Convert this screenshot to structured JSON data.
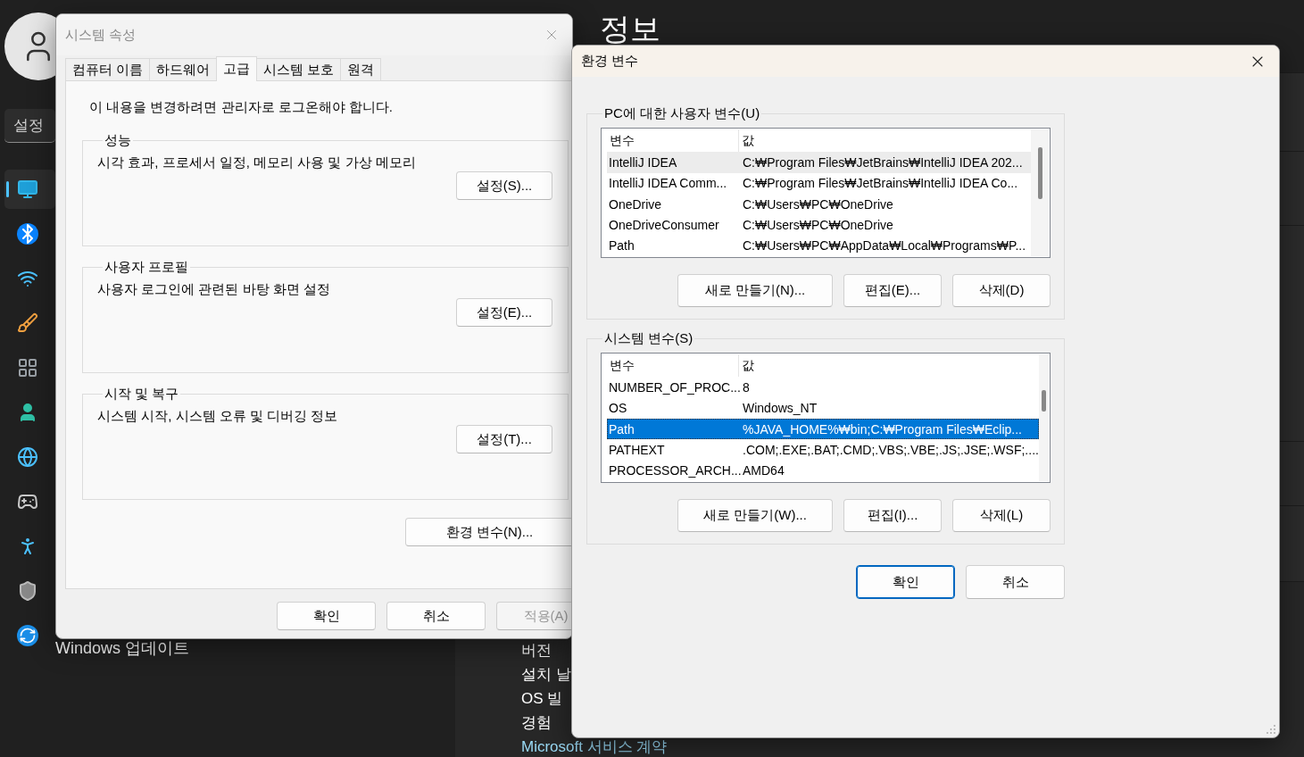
{
  "settings_app": {
    "heading": "정보",
    "search": {
      "placeholder": "설정"
    },
    "nav_items": [
      {
        "kind": "display",
        "selected": true
      },
      {
        "kind": "bluetooth",
        "selected": false
      },
      {
        "kind": "wifi",
        "selected": false
      },
      {
        "kind": "brush",
        "selected": false
      },
      {
        "kind": "apps",
        "selected": false
      },
      {
        "kind": "person",
        "selected": false
      },
      {
        "kind": "time",
        "selected": false
      },
      {
        "kind": "gaming",
        "selected": false
      },
      {
        "kind": "accessibility",
        "selected": false
      },
      {
        "kind": "shield",
        "selected": false
      },
      {
        "kind": "update",
        "selected": false,
        "label": "Windows 업데이트"
      }
    ],
    "info_rows": [
      "버전",
      "설치 날",
      "OS 빌",
      "경험"
    ],
    "link": "Microsoft 서비스 계약"
  },
  "system_properties": {
    "title": "시스템 속성",
    "tabs": [
      {
        "label": "컴퓨터 이름",
        "selected": false
      },
      {
        "label": "하드웨어",
        "selected": false
      },
      {
        "label": "고급",
        "selected": true
      },
      {
        "label": "시스템 보호",
        "selected": false
      },
      {
        "label": "원격",
        "selected": false
      }
    ],
    "notice": "이 내용을 변경하려면 관리자로 로그온해야 합니다.",
    "groups": [
      {
        "title": "성능",
        "description": "시각 효과, 프로세서 일정, 메모리 사용 및 가상 메모리",
        "button": "설정(S)..."
      },
      {
        "title": "사용자 프로필",
        "description": "사용자 로그인에 관련된 바탕 화면 설정",
        "button": "설정(E)..."
      },
      {
        "title": "시작 및 복구",
        "description": "시스템 시작, 시스템 오류 및 디버깅 정보",
        "button": "설정(T)..."
      }
    ],
    "env_button": "환경 변수(N)...",
    "buttons": [
      {
        "label": "확인",
        "disabled": false
      },
      {
        "label": "취소",
        "disabled": false
      },
      {
        "label": "적용(A)",
        "disabled": true
      }
    ]
  },
  "environment_variables": {
    "title": "환경 변수",
    "groups": [
      {
        "title": "PC에 대한 사용자 변수(U)",
        "focused": false,
        "columns": [
          "변수",
          "값"
        ],
        "rows": [
          {
            "name": "IntelliJ IDEA",
            "value": "C:₩Program Files₩JetBrains₩IntelliJ IDEA 202...",
            "selected": true
          },
          {
            "name": "IntelliJ IDEA Comm...",
            "value": "C:₩Program Files₩JetBrains₩IntelliJ IDEA Co...",
            "selected": false
          },
          {
            "name": "OneDrive",
            "value": "C:₩Users₩PC₩OneDrive",
            "selected": false
          },
          {
            "name": "OneDriveConsumer",
            "value": "C:₩Users₩PC₩OneDrive",
            "selected": false
          },
          {
            "name": "Path",
            "value": "C:₩Users₩PC₩AppData₩Local₩Programs₩P...",
            "selected": false
          }
        ],
        "buttons": [
          "새로 만들기(N)...",
          "편집(E)...",
          "삭제(D)"
        ]
      },
      {
        "title": "시스템 변수(S)",
        "focused": true,
        "columns": [
          "변수",
          "값"
        ],
        "rows": [
          {
            "name": "NUMBER_OF_PROC...",
            "value": "8",
            "selected": false
          },
          {
            "name": "OS",
            "value": "Windows_NT",
            "selected": false
          },
          {
            "name": "Path",
            "value": "%JAVA_HOME%₩bin;C:₩Program Files₩Eclip...",
            "selected": true
          },
          {
            "name": "PATHEXT",
            "value": ".COM;.EXE;.BAT;.CMD;.VBS;.VBE;.JS;.JSE;.WSF;....",
            "selected": false
          },
          {
            "name": "PROCESSOR_ARCH...",
            "value": "AMD64",
            "selected": false
          }
        ],
        "buttons": [
          "새로 만들기(W)...",
          "편집(I)...",
          "삭제(L)"
        ]
      }
    ],
    "buttons": [
      {
        "label": "확인",
        "default": true
      },
      {
        "label": "취소",
        "default": false
      }
    ]
  }
}
